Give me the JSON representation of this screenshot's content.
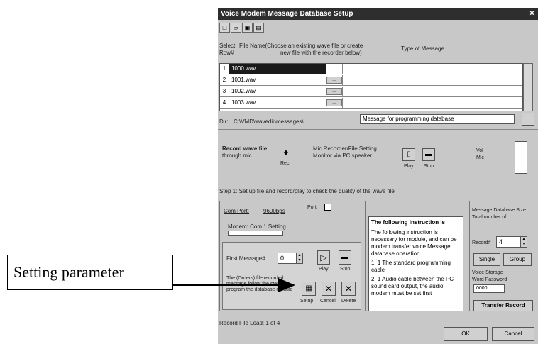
{
  "window": {
    "title": "Voice Modem Message Database Setup",
    "close_glyph": "×"
  },
  "toolbar": {
    "buttons": [
      "new-icon",
      "open-icon",
      "save-icon",
      "print-icon"
    ]
  },
  "headers": {
    "select_line1": "Select",
    "select_line2": "Row#",
    "file": "File Name(Choose an existing wave file or create",
    "file2": "new file with the recorder below)",
    "type": "Type of Message"
  },
  "grid_rows": [
    {
      "num": "1",
      "code": "1000.wav",
      "type": ""
    },
    {
      "num": "2",
      "code": "1001.wav",
      "type": ""
    },
    {
      "num": "3",
      "code": "1002.wav",
      "type": ""
    },
    {
      "num": "4",
      "code": "1003.wav",
      "type": ""
    }
  ],
  "dir_row": {
    "label": "Dir:",
    "path": "C:\\VMD\\wavedir\\messages\\",
    "message_type": "Message for programming database"
  },
  "recorder": {
    "record_label": "Record wave file",
    "record_sub": "through mic",
    "rec_caption": "Rec",
    "mic_label": "Mic Recorder/File Setting",
    "mic_sub": "Monitor via PC speaker",
    "play_caption": "Play",
    "stop_caption": "Stop",
    "vol_label": "Vol",
    "vol_label2": "Mic",
    "info": "Step 1: Set up file and record/play to check the quality of the wave file"
  },
  "modem": {
    "tab1": "Com Port: ",
    "tab2": "9600bps",
    "label": "Modem: Com 1 Setting",
    "port_check": "Port",
    "first_message_label": "First Message#",
    "first_message_value": "0",
    "play_caption": "Play",
    "stop_caption": "Stop",
    "footer_text": "The (Orders) file recorded message follow the steps to program the database module",
    "action_captions": [
      "Setup",
      "Cancel",
      "Delete"
    ]
  },
  "instructions": {
    "title": "The following instruction is",
    "lines": [
      "The following instruction is necessary for module, and can be",
      "modem transfer voice Message database operation.",
      "1. 1 The standard programming cable",
      "2. 1 Audio cable between the PC sound card output, the audio",
      "modem must be set first"
    ]
  },
  "right_panel": {
    "title": "Message Database Size:",
    "sub": "Total number of",
    "record_label": "Record#",
    "record_value": "4",
    "single_label": "Single",
    "group_label": "Group",
    "voice_label": "Voice Storage",
    "word_label": "Word Password",
    "password_value": "0000",
    "transfer_label": "Transfer Record"
  },
  "status": {
    "text": "Record File Load: 1 of 4",
    "ok_label": "OK",
    "cancel_label": "Cancel"
  },
  "callout": {
    "text": "Setting parameter"
  }
}
